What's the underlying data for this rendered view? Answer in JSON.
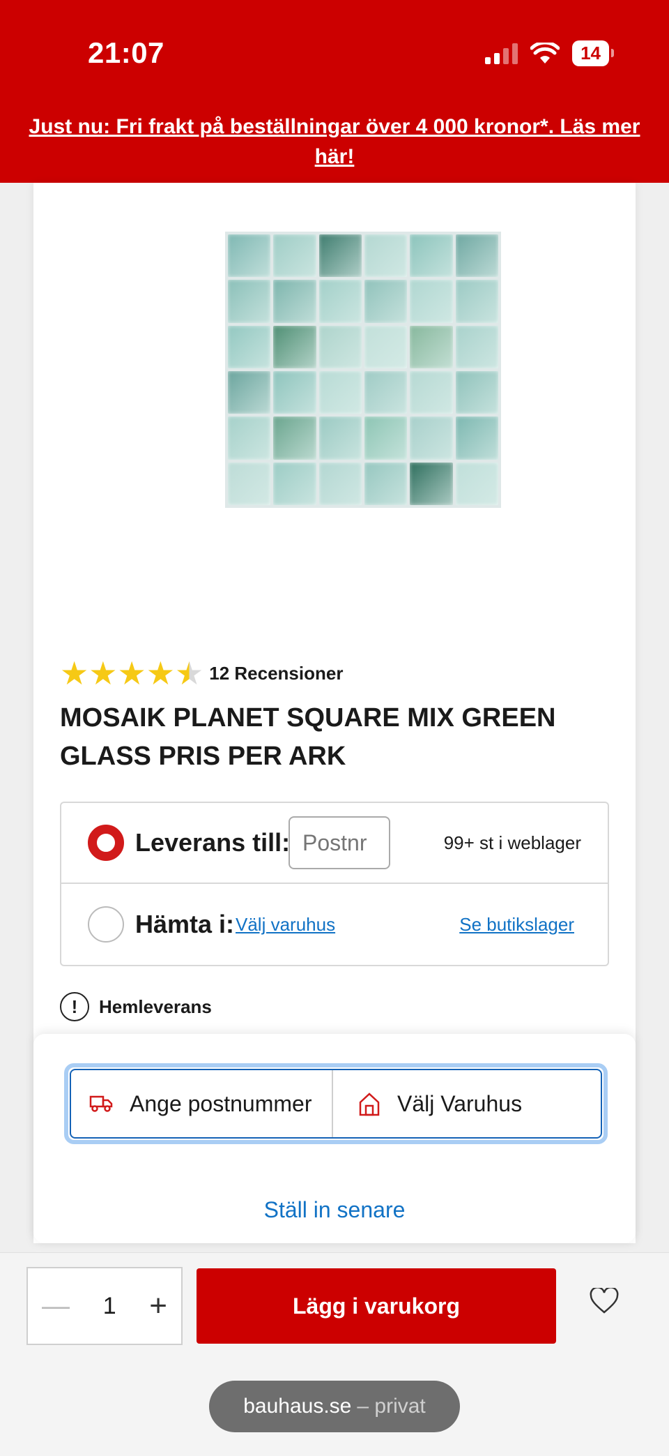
{
  "status_bar": {
    "time": "21:07",
    "battery": "14"
  },
  "promo": {
    "text": "Just nu: Fri frakt på beställningar över 4 000 kronor*. Läs mer här!"
  },
  "product": {
    "rating_value": 4.5,
    "review_count": "12 Recensioner",
    "title": "MOSAIK PLANET SQUARE MIX GREEN GLASS PRIS PER ARK",
    "image_icon": "mosaic-tile-image"
  },
  "delivery": {
    "delivery_label": "Leverans till:",
    "postnr_placeholder": "Postnr",
    "stock": "99+ st i weblager",
    "pickup_label": "Hämta i:",
    "choose_store_link": "Välj varuhus",
    "store_stock_link": "Se butikslager",
    "home_delivery": "Hemleverans"
  },
  "sheet": {
    "postcode_button": "Ange postnummer",
    "store_button": "Välj Varuhus",
    "later_link": "Ställ in senare"
  },
  "footer": {
    "quantity": "1",
    "add_to_cart": "Lägg i varukorg",
    "url": "bauhaus.se",
    "url_suffix": "– privat"
  },
  "colors": {
    "brand_red": "#cc0000",
    "link_blue": "#1172c5",
    "star_yellow": "#f6c915"
  }
}
